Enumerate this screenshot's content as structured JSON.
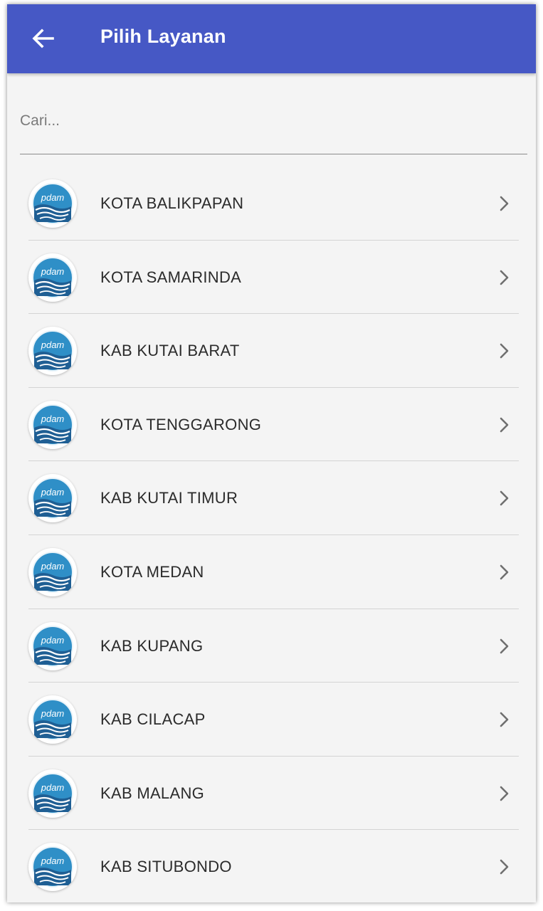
{
  "app_bar": {
    "title": "Pilih Layanan",
    "back_icon": "arrow-left-icon",
    "color": "#4658c5"
  },
  "search": {
    "placeholder": "Cari...",
    "value": ""
  },
  "items": [
    {
      "label": "KOTA BALIKPAPAN",
      "logo_text": "pdam"
    },
    {
      "label": "KOTA SAMARINDA",
      "logo_text": "pdam"
    },
    {
      "label": "KAB KUTAI BARAT",
      "logo_text": "pdam"
    },
    {
      "label": "KOTA TENGGARONG",
      "logo_text": "pdam"
    },
    {
      "label": "KAB KUTAI TIMUR",
      "logo_text": "pdam"
    },
    {
      "label": "KOTA MEDAN",
      "logo_text": "pdam"
    },
    {
      "label": "KAB KUPANG",
      "logo_text": "pdam"
    },
    {
      "label": "KAB CILACAP",
      "logo_text": "pdam"
    },
    {
      "label": "KAB MALANG",
      "logo_text": "pdam"
    },
    {
      "label": "KAB SITUBONDO",
      "logo_text": "pdam"
    }
  ]
}
